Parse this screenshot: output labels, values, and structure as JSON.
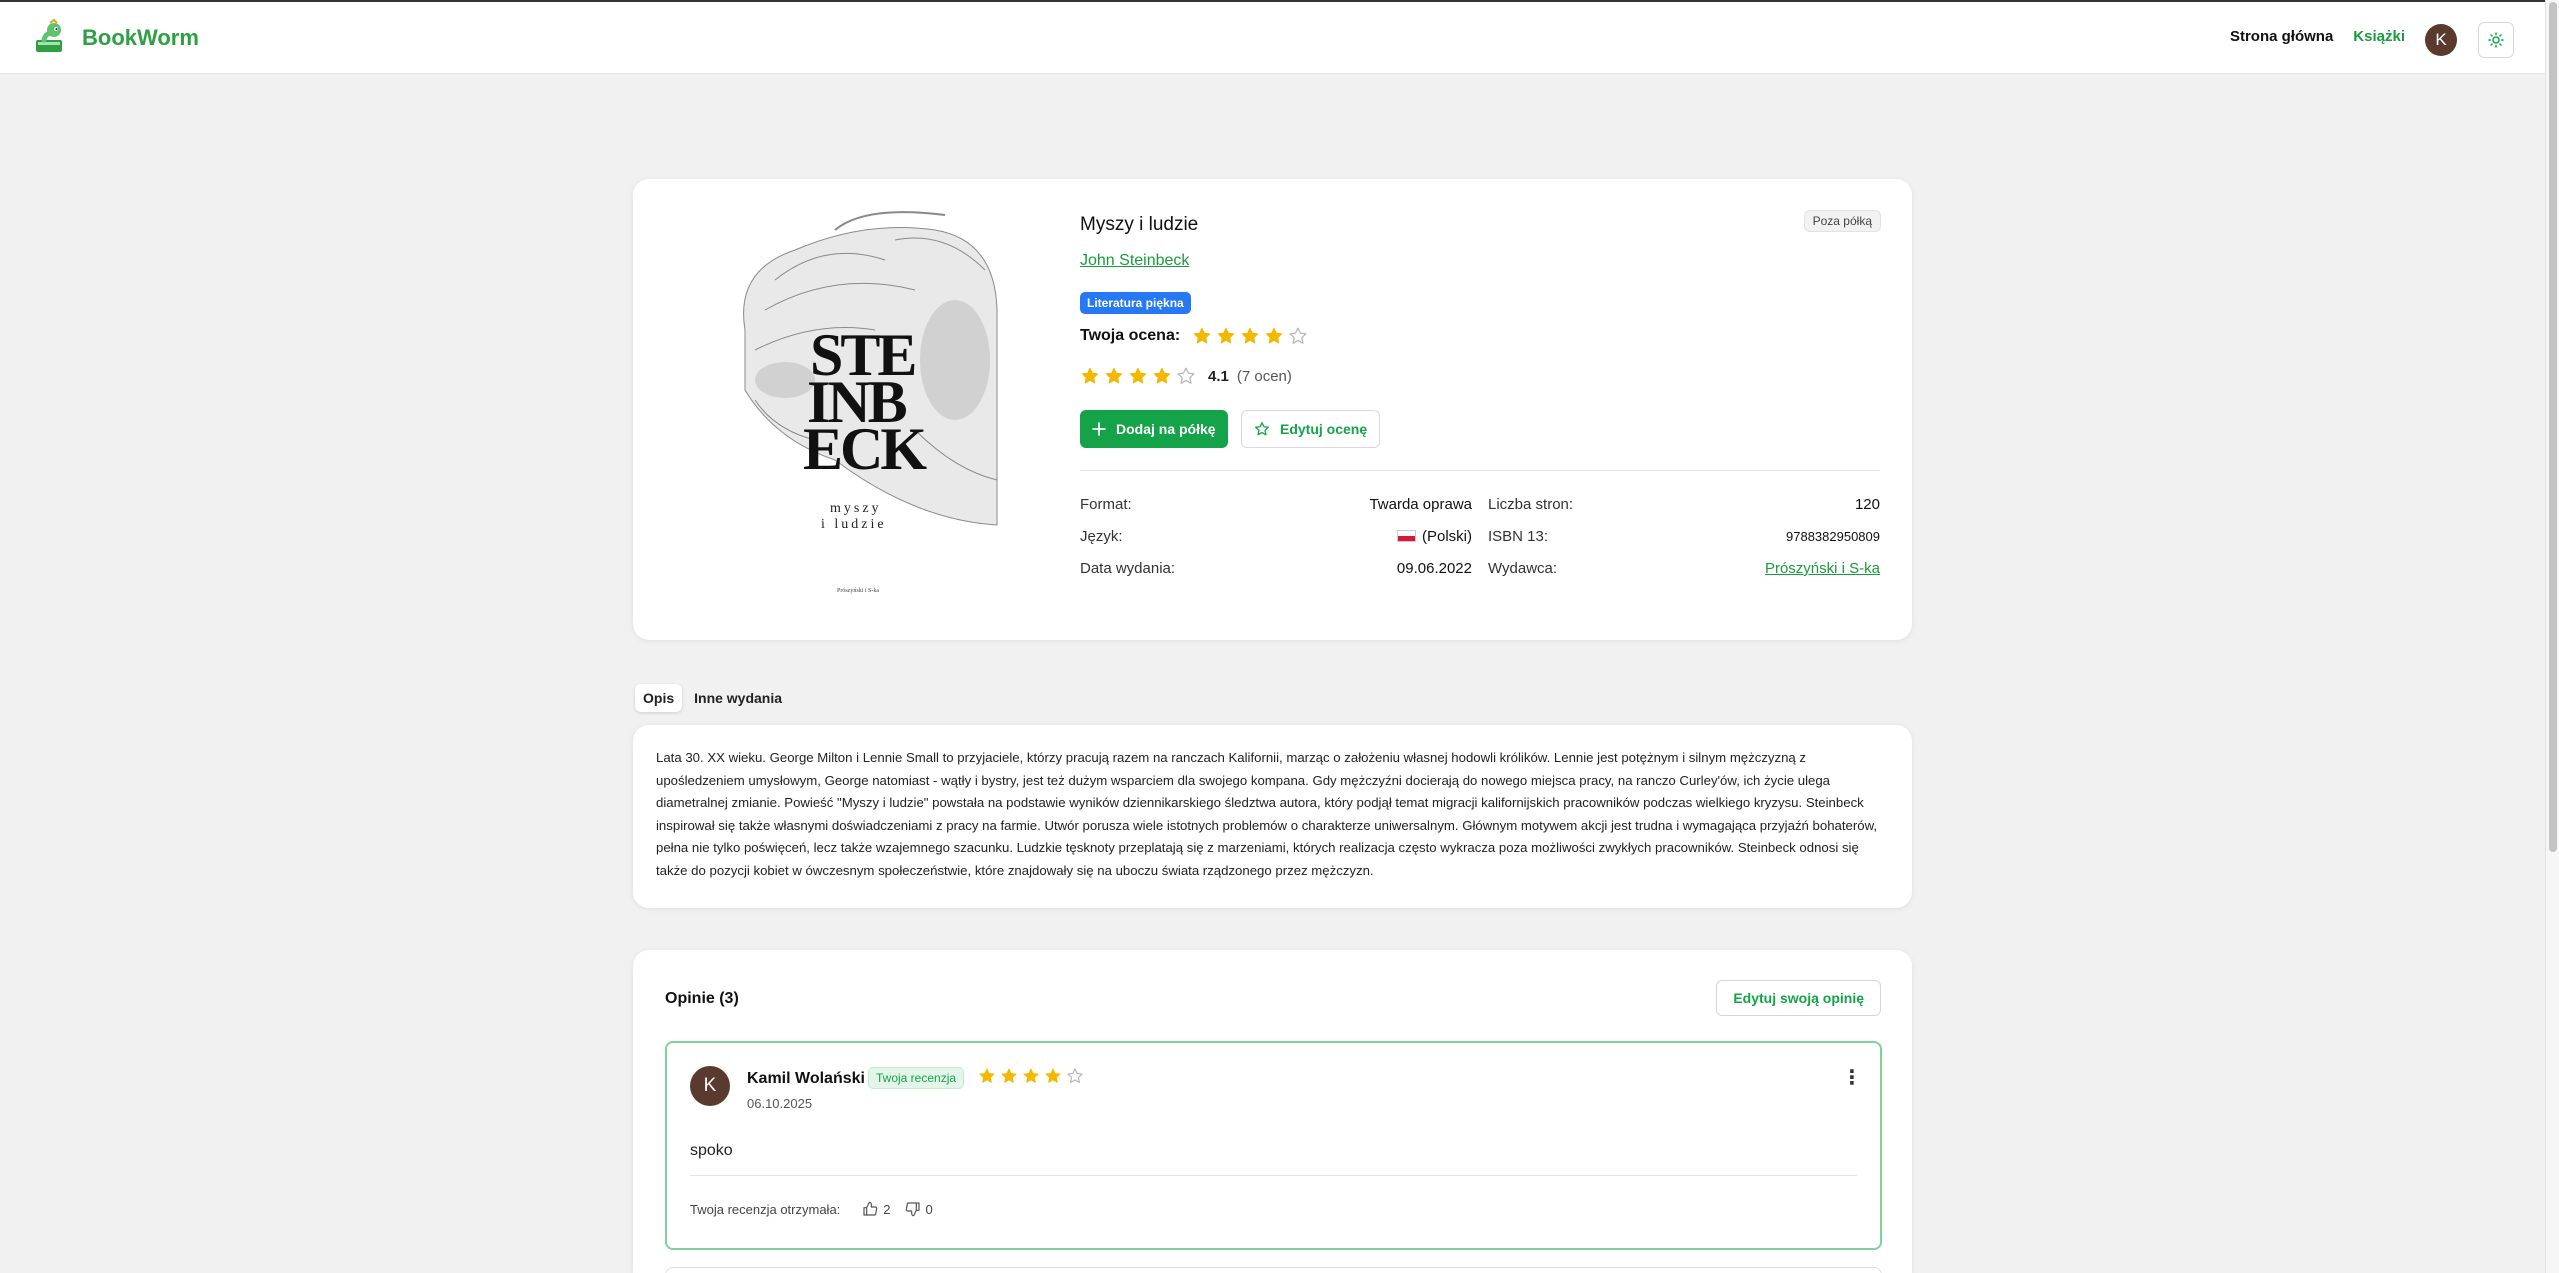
{
  "app": {
    "name": "BookWorm",
    "brand_color": "#2ea043",
    "accent_color": "#15a34a"
  },
  "nav": {
    "home": "Strona główna",
    "books": "Książki",
    "user_initial": "K",
    "theme_icon": "sun-icon"
  },
  "book": {
    "title": "Myszy i ludzie",
    "author": "John Steinbeck",
    "shelf_status": "Poza półką",
    "genre": "Literatura piękna",
    "genre_color": "#2679f2",
    "your_rating_label": "Twoja ocena:",
    "your_rating": 4,
    "average_rating": 4.1,
    "average_rating_text": "4.1",
    "ratings_count_text": "(7 ocen)",
    "add_to_shelf_label": "Dodaj na półkę",
    "edit_rating_label": "Edytuj ocenę",
    "cover": {
      "letters_line1": "STE",
      "letters_line2": "INB",
      "letters_line3": "ECK",
      "subtitle_line1": "myszy",
      "subtitle_line2": "i ludzie",
      "publisher_mark": "Prószyński i S-ka"
    },
    "details": {
      "format_label": "Format:",
      "format_value": "Twarda oprawa",
      "pages_label": "Liczba stron:",
      "pages_value": "120",
      "language_label": "Język:",
      "language_value": "(Polski)",
      "isbn_label": "ISBN 13:",
      "isbn_value": "9788382950809",
      "date_label": "Data wydania:",
      "date_value": "09.06.2022",
      "publisher_label": "Wydawca:",
      "publisher_value": "Prószyński i S-ka"
    }
  },
  "tabs": [
    {
      "label": "Opis",
      "active": true
    },
    {
      "label": "Inne wydania",
      "active": false
    }
  ],
  "description": "Lata 30. XX wieku. George Milton i Lennie Small to przyjaciele, którzy pracują razem na ranczach Kalifornii, marząc o założeniu własnej hodowli królików. Lennie jest potężnym i silnym mężczyzną z upośledzeniem umysłowym, George natomiast - wątły i bystry, jest też dużym wsparciem dla swojego kompana. Gdy mężczyźni docierają do nowego miejsca pracy, na ranczo Curley'ów, ich życie ulega diametralnej zmianie. Powieść \"Myszy i ludzie\" powstała na podstawie wyników dziennikarskiego śledztwa autora, który podjął temat migracji kalifornijskich pracowników podczas wielkiego kryzysu. Steinbeck inspirował się także własnymi doświadczeniami z pracy na farmie. Utwór porusza wiele istotnych problemów o charakterze uniwersalnym. Głównym motywem akcji jest trudna i wymagająca przyjaźń bohaterów, pełna nie tylko poświęceń, lecz także wzajemnego szacunku. Ludzkie tęsknoty przeplatają się z marzeniami, których realizacja często wykracza poza możliwości zwykłych pracowników. Steinbeck odnosi się także do pozycji kobiet w ówczesnym społeczeństwie, które znajdowały się na uboczu świata rządzonego przez mężczyzn.",
  "reviews": {
    "title": "Opinie (3)",
    "edit_button": "Edytuj swoją opinię",
    "items": [
      {
        "initial": "K",
        "author": "Kamil Wolański",
        "badge": "Twoja recenzja",
        "rating": 4,
        "date": "06.10.2025",
        "text": "spoko",
        "footer_label": "Twoja recenzja otrzymała:",
        "likes": "2",
        "dislikes": "0"
      }
    ]
  }
}
